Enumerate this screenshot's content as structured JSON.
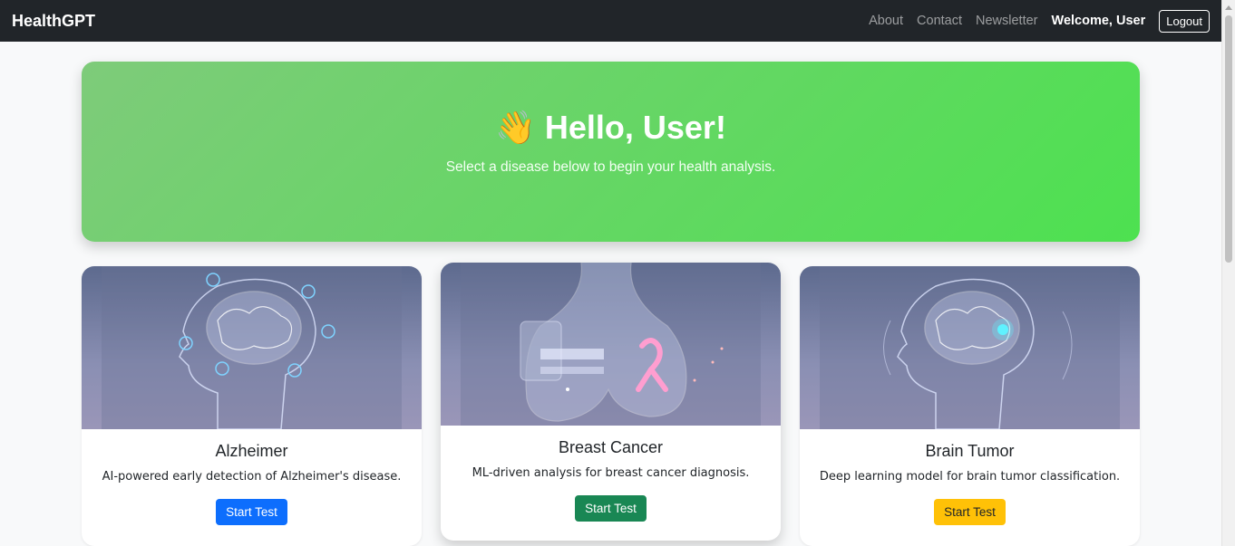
{
  "navbar": {
    "brand": "HealthGPT",
    "links": [
      "About",
      "Contact",
      "Newsletter"
    ],
    "welcome_prefix": "Welcome,",
    "welcome_user": "User",
    "logout_label": "Logout"
  },
  "hero": {
    "emoji": "👋",
    "title": "Hello, User!",
    "subtitle": "Select a disease below to begin your health analysis."
  },
  "cards": [
    {
      "title": "Alzheimer",
      "description": "AI-powered early detection of Alzheimer's disease.",
      "button": "Start Test",
      "button_color": "#0d6efd",
      "image": "brain-icon"
    },
    {
      "title": "Breast Cancer",
      "description": "ML-driven analysis for breast cancer diagnosis.",
      "button": "Start Test",
      "button_color": "#198754",
      "image": "ribbon-icon"
    },
    {
      "title": "Brain Tumor",
      "description": "Deep learning model for brain tumor classification.",
      "button": "Start Test",
      "button_color": "#ffc107",
      "image": "brain-icon"
    }
  ],
  "colors": {
    "navbar": "#212529",
    "hero_start": "#7ecb7a",
    "hero_end": "#4de150"
  }
}
